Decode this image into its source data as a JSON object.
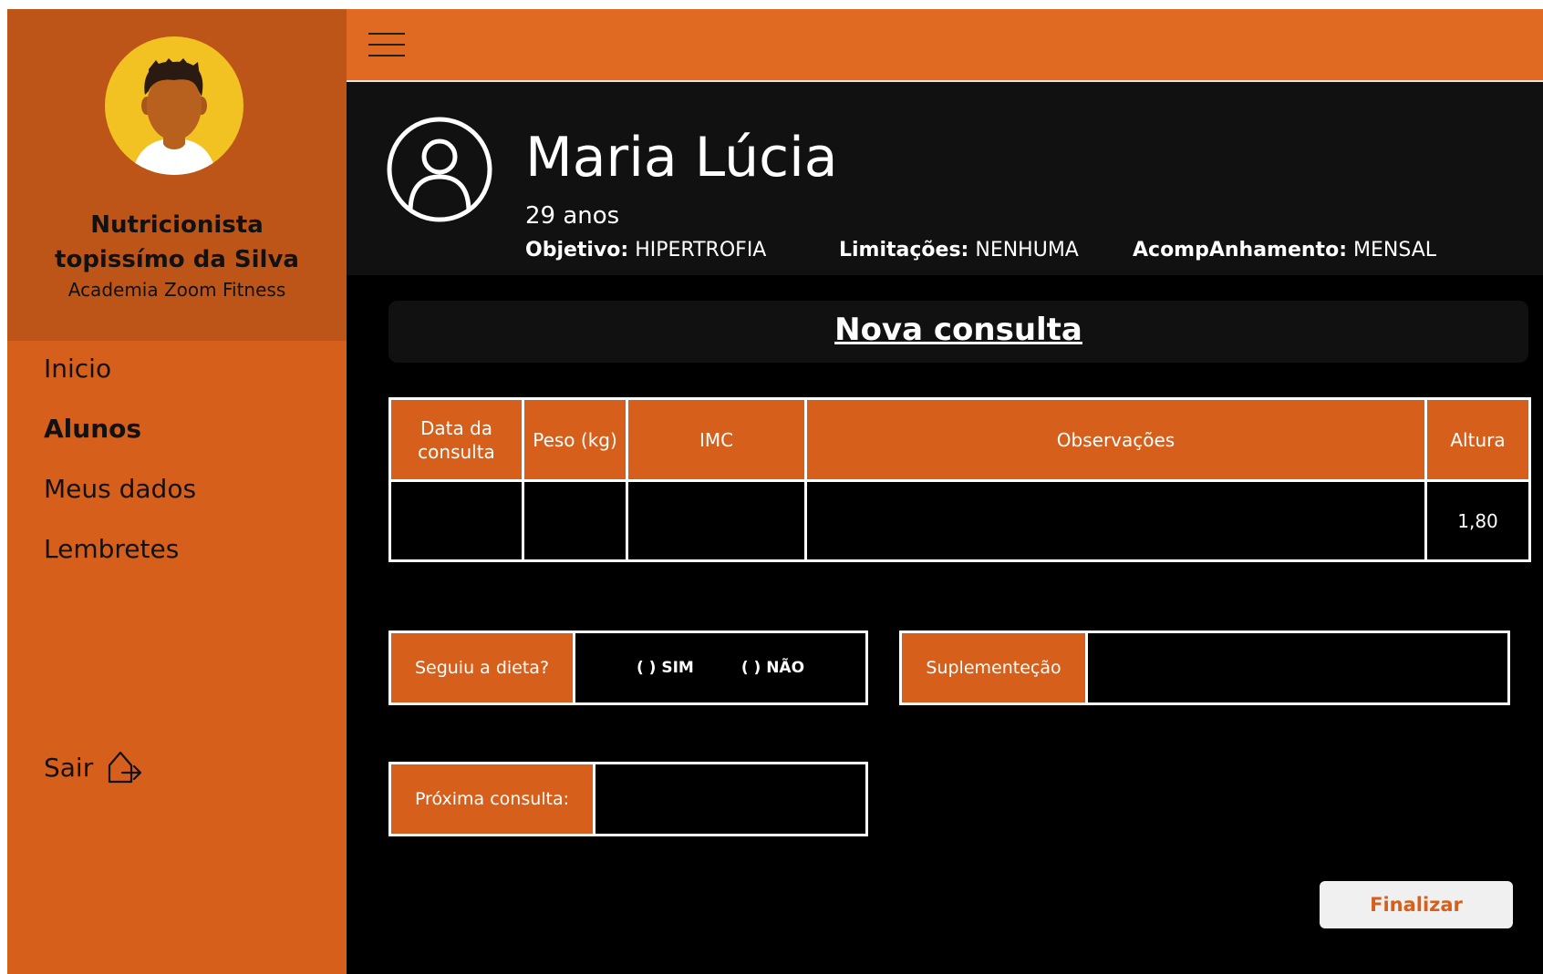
{
  "sidebar": {
    "nutritionist_line1": "Nutricionista",
    "nutritionist_line2": "topissímo da Silva",
    "gym": "Academia Zoom Fitness",
    "nav": [
      "Inicio",
      "Alunos",
      "Meus dados",
      "Lembretes"
    ],
    "logout_label": "Sair",
    "active_item": "Alunos"
  },
  "topbar": {
    "menu_icon": "hamburger-menu-icon"
  },
  "patient": {
    "name": "Maria Lúcia",
    "age": "29 anos",
    "goal_label": "Objetivo:",
    "goal_value": "HIPERTROFIA",
    "limits_label": "Limitações:",
    "limits_value": "NENHUMA",
    "followup_label": "AcompAnhamento:",
    "followup_value": "MENSAL"
  },
  "consulta": {
    "title": "Nova consulta",
    "columns": [
      "Data da consulta",
      "Peso (kg)",
      "IMC",
      "Observações",
      "Altura"
    ],
    "row": [
      "",
      "",
      "",
      "",
      "1,80"
    ],
    "diet_label": "Seguiu a dieta?",
    "diet_yes": "( ) SIM",
    "diet_no": "( ) NÃO",
    "supplement_label": "Suplementeção",
    "next_label": "Próxima consulta:",
    "finalize_label": "Finalizar"
  },
  "colors": {
    "sidebar": "#d65f1b",
    "profile_card": "#bd5518",
    "topbar": "#e06a22",
    "avatar_bg": "#f1c221",
    "background": "#000000"
  }
}
